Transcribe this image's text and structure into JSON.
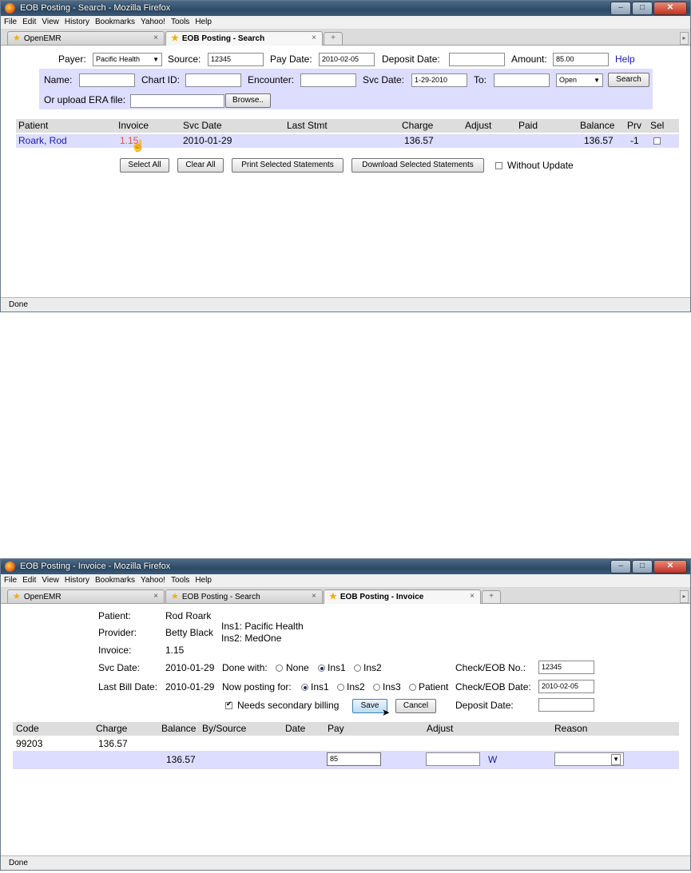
{
  "win1": {
    "title": "EOB Posting - Search - Mozilla Firefox",
    "menu": [
      "File",
      "Edit",
      "View",
      "History",
      "Bookmarks",
      "Yahoo!",
      "Tools",
      "Help"
    ],
    "tabs": [
      {
        "label": "OpenEMR"
      },
      {
        "label": "EOB Posting - Search"
      }
    ],
    "form": {
      "payer_label": "Payer:",
      "payer_value": "Pacific Health",
      "source_label": "Source:",
      "source_value": "12345",
      "paydate_label": "Pay Date:",
      "paydate_value": "2010-02-05",
      "deposit_label": "Deposit Date:",
      "deposit_value": "",
      "amount_label": "Amount:",
      "amount_value": "85.00",
      "help": "Help",
      "name_label": "Name:",
      "name_value": "",
      "chart_label": "Chart ID:",
      "chart_value": "",
      "enc_label": "Encounter:",
      "enc_value": "",
      "svc_label": "Svc Date:",
      "svc_value": "1-29-2010",
      "to_label": "To:",
      "to_value": "",
      "status_value": "Open",
      "search_button": "Search",
      "era_label": "Or upload ERA file:",
      "browse_button": "Browse.."
    },
    "table": {
      "headers": [
        "Patient",
        "Invoice",
        "Svc Date",
        "Last Stmt",
        "Charge",
        "Adjust",
        "Paid",
        "Balance",
        "Prv",
        "Sel"
      ],
      "row": {
        "patient": "Roark, Rod",
        "invoice": "1.15",
        "svc_date": "2010-01-29",
        "last_stmt": "",
        "charge": "136.57",
        "adjust": "",
        "paid": "",
        "balance": "136.57",
        "prv": "-1"
      }
    },
    "actions": {
      "select_all": "Select All",
      "clear_all": "Clear All",
      "print": "Print Selected Statements",
      "download": "Download Selected Statements",
      "without_update": "Without Update"
    },
    "status": "Done"
  },
  "win2": {
    "title": "EOB Posting - Invoice - Mozilla Firefox",
    "menu": [
      "File",
      "Edit",
      "View",
      "History",
      "Bookmarks",
      "Yahoo!",
      "Tools",
      "Help"
    ],
    "tabs": [
      {
        "label": "OpenEMR"
      },
      {
        "label": "EOB Posting - Search"
      },
      {
        "label": "EOB Posting - Invoice"
      }
    ],
    "info": {
      "patient_label": "Patient:",
      "patient_value": "Rod Roark",
      "provider_label": "Provider:",
      "provider_value": "Betty Black",
      "ins1": "Ins1: Pacific Health",
      "ins2": "Ins2: MedOne",
      "invoice_label": "Invoice:",
      "invoice_value": "1.15",
      "svc_label": "Svc Date:",
      "svc_value": "2010-01-29",
      "lastbill_label": "Last Bill Date:",
      "lastbill_value": "2010-01-29",
      "donewith_label": "Done with:",
      "donewith_options": [
        "None",
        "Ins1",
        "Ins2"
      ],
      "posting_label": "Now posting for:",
      "posting_options": [
        "Ins1",
        "Ins2",
        "Ins3",
        "Patient"
      ],
      "check_label": "Check/EOB No.:",
      "check_value": "12345",
      "checkdate_label": "Check/EOB Date:",
      "checkdate_value": "2010-02-05",
      "deposit_label": "Deposit Date:",
      "deposit_value": "",
      "secondary_label": "Needs secondary billing",
      "save_button": "Save",
      "cancel_button": "Cancel"
    },
    "table": {
      "headers": [
        "Code",
        "Charge",
        "Balance",
        "By/Source",
        "Date",
        "Pay",
        "Adjust",
        "Reason"
      ],
      "code": "99203",
      "charge": "136.57",
      "balance": "136.57",
      "pay_value": "85",
      "adjust_value": "",
      "w": "W"
    },
    "status": "Done"
  }
}
